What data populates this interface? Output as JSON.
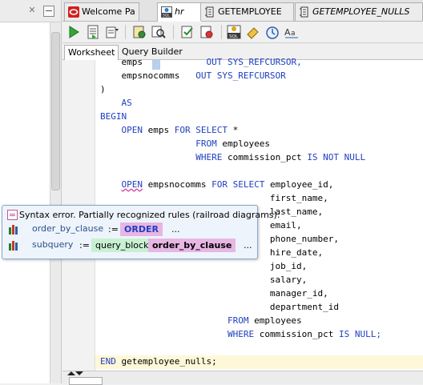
{
  "tabs": [
    {
      "label": "Welcome Pa",
      "active": false,
      "icon": "oracle-icon"
    },
    {
      "label": "hr",
      "active": true,
      "icon": "sql-worksheet-icon"
    },
    {
      "label": "GETEMPLOYEE",
      "active": false,
      "icon": "procedure-icon"
    },
    {
      "label": "GETEMPLOYEE_NULLS",
      "active": false,
      "icon": "procedure-icon"
    }
  ],
  "toolbar": {
    "buttons": [
      "run-icon",
      "run-script-icon",
      "compile-icon",
      "debug-icon",
      "search-icon",
      "compile-check-icon",
      "compile-debug-icon",
      "sql-icon",
      "eraser-icon",
      "history-icon",
      "format-text-icon"
    ]
  },
  "worksheet_tabs": [
    "Worksheet",
    "Query Builder"
  ],
  "code": {
    "lines": [
      {
        "indent": "    ",
        "parts": [
          {
            "t": "emps",
            "k": false
          },
          {
            "t": "            ",
            "k": false
          },
          {
            "t": "OUT SYS_REFCURSOR,",
            "k": true
          }
        ]
      },
      {
        "indent": "    ",
        "parts": [
          {
            "t": "empsnocomms   ",
            "k": false
          },
          {
            "t": "OUT SYS_REFCURSOR",
            "k": true
          }
        ]
      },
      {
        "indent": "",
        "parts": [
          {
            "t": ")",
            "k": false
          }
        ]
      },
      {
        "indent": "    ",
        "parts": [
          {
            "t": "AS",
            "k": true
          }
        ]
      },
      {
        "indent": "",
        "parts": [
          {
            "t": "BEGIN",
            "k": true
          }
        ]
      },
      {
        "indent": "    ",
        "parts": [
          {
            "t": "OPEN ",
            "k": true
          },
          {
            "t": "emps ",
            "k": false
          },
          {
            "t": "FOR SELECT ",
            "k": true
          },
          {
            "t": "*",
            "k": false
          }
        ]
      },
      {
        "indent": "                  ",
        "parts": [
          {
            "t": "FROM ",
            "k": true
          },
          {
            "t": "employees",
            "k": false
          }
        ]
      },
      {
        "indent": "                  ",
        "parts": [
          {
            "t": "WHERE ",
            "k": true
          },
          {
            "t": "commission_pct ",
            "k": false
          },
          {
            "t": "IS NOT NULL",
            "k": true
          }
        ]
      },
      {
        "indent": "",
        "parts": []
      },
      {
        "indent": "    ",
        "parts": [
          {
            "t": "OPEN",
            "k": true,
            "err": true
          },
          {
            "t": " empsnocomms ",
            "k": false
          },
          {
            "t": "FOR SELECT ",
            "k": true
          },
          {
            "t": "employee_id,",
            "k": false
          }
        ]
      },
      {
        "indent": "                                ",
        "parts": [
          {
            "t": "first_name,",
            "k": false
          }
        ]
      },
      {
        "indent": "                                ",
        "parts": [
          {
            "t": "last_name,",
            "k": false
          }
        ]
      },
      {
        "indent": "                                ",
        "parts": [
          {
            "t": "email,",
            "k": false
          }
        ]
      },
      {
        "indent": "                                ",
        "parts": [
          {
            "t": "phone_number,",
            "k": false
          }
        ]
      },
      {
        "indent": "                                ",
        "parts": [
          {
            "t": "hire_date,",
            "k": false
          }
        ]
      },
      {
        "indent": "                                ",
        "parts": [
          {
            "t": "job_id,",
            "k": false
          }
        ]
      },
      {
        "indent": "                                ",
        "parts": [
          {
            "t": "salary,",
            "k": false
          }
        ]
      },
      {
        "indent": "                                ",
        "parts": [
          {
            "t": "manager_id,",
            "k": false
          }
        ]
      },
      {
        "indent": "                                ",
        "parts": [
          {
            "t": "department_id",
            "k": false
          }
        ]
      },
      {
        "indent": "                        ",
        "parts": [
          {
            "t": "FROM ",
            "k": true
          },
          {
            "t": "employees",
            "k": false
          }
        ]
      },
      {
        "indent": "                        ",
        "parts": [
          {
            "t": "WHERE ",
            "k": true
          },
          {
            "t": "commission_pct ",
            "k": false
          },
          {
            "t": "IS NULL;",
            "k": true
          }
        ]
      },
      {
        "indent": "",
        "parts": []
      },
      {
        "indent": "",
        "parts": [
          {
            "t": "END ",
            "k": true
          },
          {
            "t": "getemployee_nulls;",
            "k": false
          }
        ]
      }
    ]
  },
  "popup": {
    "title": "Syntax error. Partially recognized rules (railroad diagrams):",
    "rows": [
      {
        "rule": "order_by_clause",
        "assign": ":=",
        "tokens": [
          {
            "t": "ORDER",
            "style": "kwtok"
          }
        ],
        "ellipsis": "..."
      },
      {
        "rule": "subquery",
        "assign": ":=",
        "tokens": [
          {
            "t": "query_block",
            "style": "nt"
          },
          {
            "t": "order_by_clause",
            "style": "nt2"
          }
        ],
        "ellipsis": "..."
      }
    ]
  },
  "colors": {
    "keyword": "#1f3fbf",
    "error_underline": "#d0249a",
    "current_line": "#fff8d8"
  }
}
